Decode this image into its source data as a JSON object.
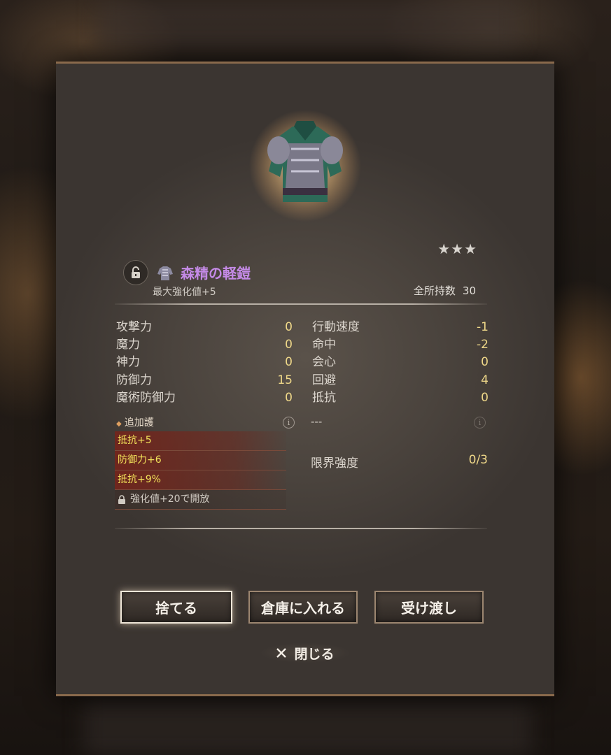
{
  "item": {
    "name": "森精の軽鎧",
    "rarity_stars": "★★★",
    "max_enhance": "最大強化値+5",
    "owned_label": "全所持数",
    "owned_count": "30"
  },
  "stats_left": [
    {
      "label": "攻撃力",
      "value": "0"
    },
    {
      "label": "魔力",
      "value": "0"
    },
    {
      "label": "神力",
      "value": "0"
    },
    {
      "label": "防御力",
      "value": "15"
    },
    {
      "label": "魔術防御力",
      "value": "0"
    }
  ],
  "stats_right": [
    {
      "label": "行動速度",
      "value": "-1"
    },
    {
      "label": "命中",
      "value": "-2"
    },
    {
      "label": "会心",
      "value": "0"
    },
    {
      "label": "回避",
      "value": "4"
    },
    {
      "label": "抵抗",
      "value": "0"
    }
  ],
  "additional": {
    "title": "追加護",
    "options": [
      "抵抗+5",
      "防御力+6",
      "抵抗+9%"
    ],
    "locked_text": "強化値+20で開放",
    "right_placeholder": "---"
  },
  "limit": {
    "label": "限界強度",
    "value": "0/3"
  },
  "buttons": {
    "discard": "捨てる",
    "storage": "倉庫に入れる",
    "transfer": "受け渡し",
    "close": "閉じる"
  },
  "icons": {
    "lock": "lock-icon",
    "armor": "armor-icon",
    "info": "info-icon",
    "close": "close-icon"
  },
  "colors": {
    "item_name": "#c48ae6",
    "stat_value": "#efd889",
    "option_text": "#f3e35a",
    "frame_accent": "#8a6a4c"
  }
}
